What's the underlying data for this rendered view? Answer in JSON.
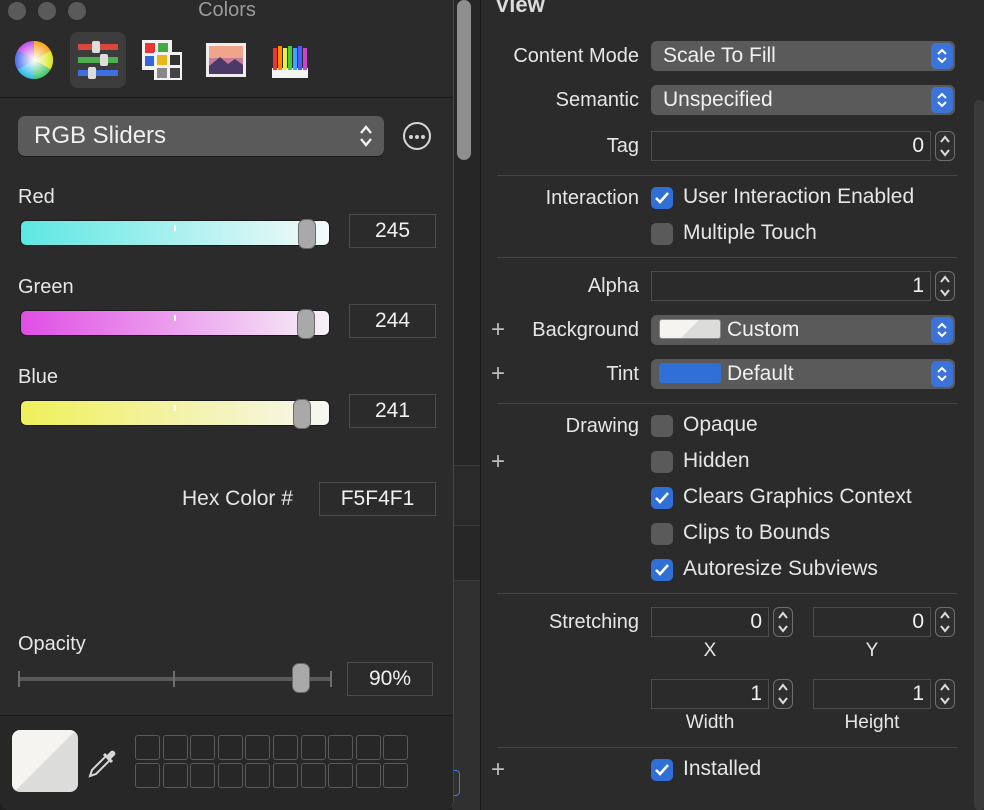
{
  "colors_panel": {
    "title": "Colors",
    "modes": [
      "color-wheel-icon",
      "sliders-icon",
      "palettes-icon",
      "image-palettes-icon",
      "pencils-icon"
    ],
    "picker_mode": "RGB Sliders",
    "sliders": [
      {
        "label": "Red",
        "value": "245",
        "fraction": 0.961
      },
      {
        "label": "Green",
        "value": "244",
        "fraction": 0.957
      },
      {
        "label": "Blue",
        "value": "241",
        "fraction": 0.945
      }
    ],
    "hex_label": "Hex Color #",
    "hex_value": "F5F4F1",
    "opacity_label": "Opacity",
    "opacity_value": "90%",
    "opacity_fraction": 0.9,
    "current_color": "#F5F4F1"
  },
  "inspector": {
    "section_title": "View",
    "content_mode": {
      "label": "Content Mode",
      "value": "Scale To Fill"
    },
    "semantic": {
      "label": "Semantic",
      "value": "Unspecified"
    },
    "tag": {
      "label": "Tag",
      "value": "0"
    },
    "interaction": {
      "label": "Interaction",
      "options": [
        {
          "label": "User Interaction Enabled",
          "checked": true
        },
        {
          "label": "Multiple Touch",
          "checked": false
        }
      ]
    },
    "alpha": {
      "label": "Alpha",
      "value": "1"
    },
    "background": {
      "label": "Background",
      "value": "Custom",
      "color": "#F5F4F1"
    },
    "tint": {
      "label": "Tint",
      "value": "Default",
      "color": "#2F6FD6"
    },
    "drawing": {
      "label": "Drawing",
      "options": [
        {
          "label": "Opaque",
          "checked": false
        },
        {
          "label": "Hidden",
          "checked": false
        },
        {
          "label": "Clears Graphics Context",
          "checked": true
        },
        {
          "label": "Clips to Bounds",
          "checked": false
        },
        {
          "label": "Autoresize Subviews",
          "checked": true
        }
      ]
    },
    "stretching": {
      "label": "Stretching",
      "x": {
        "label": "X",
        "value": "0"
      },
      "y": {
        "label": "Y",
        "value": "0"
      },
      "width": {
        "label": "Width",
        "value": "1"
      },
      "height": {
        "label": "Height",
        "value": "1"
      }
    },
    "installed": {
      "label": "Installed",
      "checked": true
    },
    "plus_symbol": "+"
  }
}
